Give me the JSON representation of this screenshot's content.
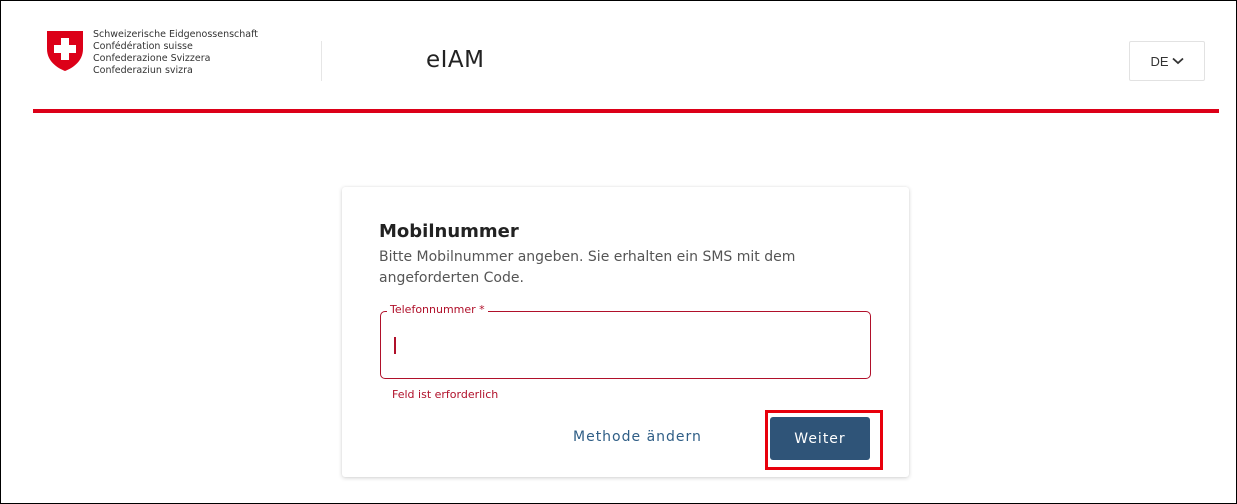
{
  "header": {
    "confederation_lines": [
      "Schweizerische Eidgenossenschaft",
      "Confédération suisse",
      "Confederazione Svizzera",
      "Confederaziun svizra"
    ],
    "app_title": "eIAM",
    "language": "DE",
    "logo_icon": "swiss-cross-shield-icon",
    "brand_red": "#dc0018"
  },
  "card": {
    "title": "Mobilnummer",
    "description": "Bitte Mobilnummer angeben. Sie erhalten ein SMS mit dem angeforderten Code.",
    "phone_field": {
      "label": "Telefonnummer *",
      "value": "",
      "error": "Feld ist erforderlich",
      "error_color": "#b0102a"
    },
    "change_method_label": "Methode ändern",
    "continue_label": "Weiter",
    "primary_color": "#2f5478"
  }
}
